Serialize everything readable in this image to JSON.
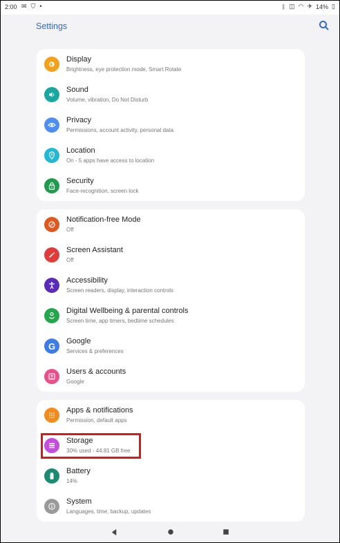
{
  "status_bar": {
    "time": "2:00",
    "battery": "14%",
    "left_icons": [
      "gmail-icon",
      "shield-icon",
      "dot-icon"
    ],
    "right_icons": [
      "bluetooth-icon",
      "vibrate-icon",
      "wifi-icon",
      "airplane-icon",
      "battery-icon"
    ]
  },
  "app_bar": {
    "title": "Settings",
    "search_icon": "search-icon"
  },
  "groups": [
    {
      "items": [
        {
          "name": "display",
          "title": "Display",
          "subtitle": "Brightness, eye protection mode, Smart Rotate",
          "icon": "display-icon",
          "color": "#f4a01a"
        },
        {
          "name": "sound",
          "title": "Sound",
          "subtitle": "Volume, vibration, Do Not Disturb",
          "icon": "sound-icon",
          "color": "#17a7a0"
        },
        {
          "name": "privacy",
          "title": "Privacy",
          "subtitle": "Permissions, account activity, personal data",
          "icon": "privacy-icon",
          "color": "#4e8ef0"
        },
        {
          "name": "location",
          "title": "Location",
          "subtitle": "On - 5 apps have access to location",
          "icon": "location-icon",
          "color": "#20b8d4"
        },
        {
          "name": "security",
          "title": "Security",
          "subtitle": "Face-recognition, screen lock",
          "icon": "lock-icon",
          "color": "#1e9c4c"
        }
      ]
    },
    {
      "items": [
        {
          "name": "notification-free-mode",
          "title": "Notification-free Mode",
          "subtitle": "Off",
          "icon": "do-not-disturb-icon",
          "color": "#e2571e"
        },
        {
          "name": "screen-assistant",
          "title": "Screen Assistant",
          "subtitle": "Off",
          "icon": "wrench-icon",
          "color": "#e33a3a"
        },
        {
          "name": "accessibility",
          "title": "Accessibility",
          "subtitle": "Screen readers, display, interaction controls",
          "icon": "accessibility-icon",
          "color": "#5a2bb8"
        },
        {
          "name": "digital-wellbeing",
          "title": "Digital Wellbeing & parental controls",
          "subtitle": "Screen time, app timers, bedtime schedules",
          "icon": "wellbeing-icon",
          "color": "#22a84a"
        },
        {
          "name": "google",
          "title": "Google",
          "subtitle": "Services & preferences",
          "icon": "google-icon",
          "color": "#3c7be8"
        },
        {
          "name": "users-accounts",
          "title": "Users & accounts",
          "subtitle": "Google",
          "icon": "account-icon",
          "color": "#e9508a"
        }
      ]
    },
    {
      "items": [
        {
          "name": "apps-notifications",
          "title": "Apps & notifications",
          "subtitle": "Permission, default apps",
          "icon": "apps-grid-icon",
          "color": "#f48a1a"
        },
        {
          "name": "storage",
          "title": "Storage",
          "subtitle": "30% used - 44.81 GB free",
          "icon": "storage-icon",
          "color": "#c64be0"
        },
        {
          "name": "battery",
          "title": "Battery",
          "subtitle": "14%",
          "icon": "battery-icon",
          "color": "#1b8a72"
        },
        {
          "name": "system",
          "title": "System",
          "subtitle": "Languages, time, backup, updates",
          "icon": "info-icon",
          "color": "#9a9a9a"
        }
      ]
    }
  ],
  "nav_bar": {
    "back_icon": "back-icon",
    "home_icon": "home-icon",
    "recents_icon": "recents-icon"
  }
}
